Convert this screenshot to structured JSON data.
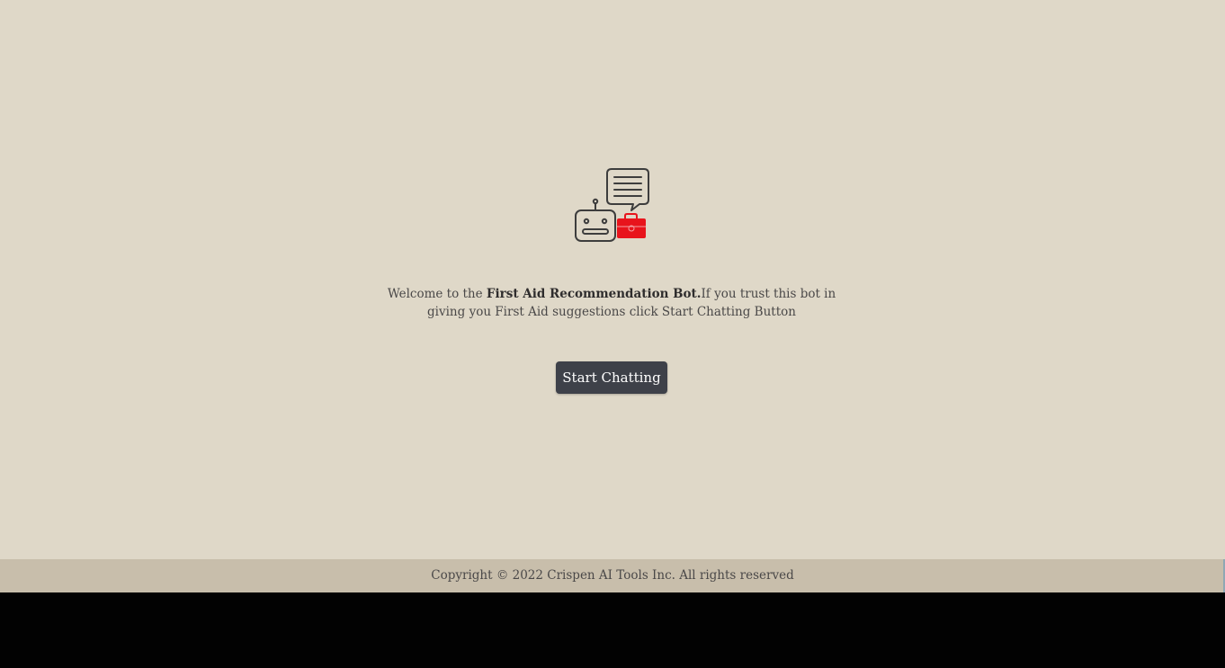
{
  "logo": {
    "icon": "robot-first-aid-chat-icon",
    "accent_color": "#e8141c",
    "line_color": "#3d3d3d"
  },
  "welcome": {
    "prefix": "Welcome to the ",
    "bot_name": "First Aid Recommendation Bot.",
    "suffix": "If you trust this bot in giving you First Aid suggestions click Start Chatting Button"
  },
  "start_button": {
    "label": "Start Chatting",
    "color": "#3e4149"
  },
  "footer": {
    "copyright": "Copyright © 2022 Crispen AI Tools Inc. All rights reserved"
  },
  "colors": {
    "background": "#dfd8c8",
    "footer_background": "#c8beab",
    "text": "#4a4848"
  }
}
